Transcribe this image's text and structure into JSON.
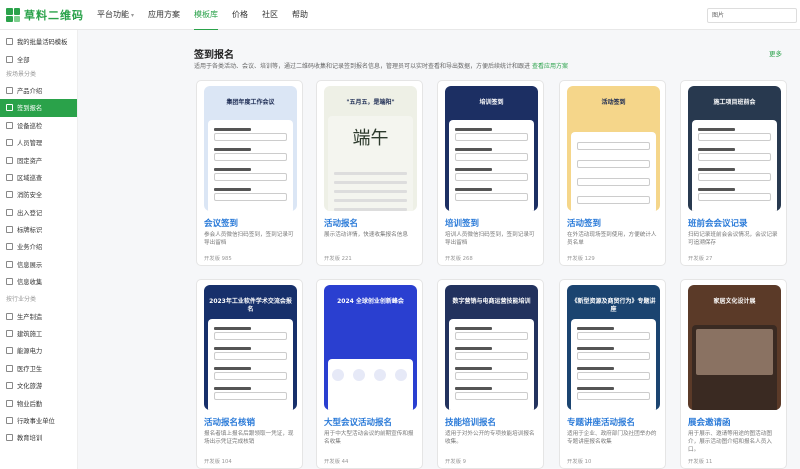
{
  "brand": {
    "name": "草料二维码",
    "accent": "#2aa24a"
  },
  "nav": [
    {
      "label": "平台功能",
      "dropdown": true
    },
    {
      "label": "应用方案",
      "dropdown": false
    },
    {
      "label": "模板库",
      "dropdown": false,
      "active": true
    },
    {
      "label": "价格",
      "dropdown": false
    },
    {
      "label": "社区",
      "dropdown": false
    },
    {
      "label": "帮助",
      "dropdown": false
    }
  ],
  "search": {
    "value": "图片"
  },
  "sidebar": {
    "my_template": "我的批量活码模板",
    "all": "全部",
    "group1": "按场景分类",
    "scenes": [
      "产品介绍",
      "签到报名",
      "设备巡检",
      "人员管理",
      "固定资产",
      "区域巡查",
      "消防安全",
      "出入登记",
      "标牌标识",
      "业务介绍",
      "信息展示",
      "信息收集"
    ],
    "group2": "按行业分类",
    "industries": [
      "生产制造",
      "建筑施工",
      "能源电力",
      "医疗卫生",
      "文化旅游",
      "物业后勤",
      "行政事业单位",
      "教育培训"
    ],
    "active_index": 1
  },
  "section": {
    "title": "签到报名",
    "desc": "适用于各类活动、会议、培训等，通过二维码收集和记录签到报名信息，管理员可以实时查看和导出数据，方便后续统计和跟进",
    "desc_link": "查看应用方案",
    "more": "更多"
  },
  "cards": [
    {
      "title": "会议签到",
      "desc": "参会人员微信扫码签到，签到记录可导出留档",
      "count": "开发版 985",
      "thumb_title": "集团年度工作会议",
      "thumb_bg": "#dbe6f5",
      "theme": "conf"
    },
    {
      "title": "活动报名",
      "desc": "展示活动详情，快速收集报名信息",
      "count": "开发版 221",
      "thumb_title": "\"五月五，是端阳\"",
      "thumb_bg": "#eef0e6",
      "theme": "dragon"
    },
    {
      "title": "培训签到",
      "desc": "培训人员微信扫码签到，签到记录可导出留档",
      "count": "开发版 268",
      "thumb_title": "培训签到",
      "thumb_bg": "#1c2f63",
      "theme": "train"
    },
    {
      "title": "活动签到",
      "desc": "在外活动现场签到使用，方便统计人员名单",
      "count": "开发版 129",
      "thumb_title": "活动签到",
      "thumb_bg": "#f5d68a",
      "theme": "event"
    },
    {
      "title": "班前会会议记录",
      "desc": "扫码记录班前会会议情况，会议记录可追溯保存",
      "count": "开发版 27",
      "thumb_title": "施工项目班前会",
      "thumb_bg": "#28394f",
      "theme": "site"
    },
    {
      "title": "活动报名核销",
      "desc": "报名者填上报名后跟领取一凭证，现场出示凭证完成核销",
      "count": "开发版 104",
      "thumb_title": "2023年工业软件学术交流会报名",
      "thumb_bg": "#17306b",
      "theme": "soft"
    },
    {
      "title": "大型会议活动报名",
      "desc": "用于中大型活动会议的前期宣传和报名收集",
      "count": "开发版 44",
      "thumb_title": "2024 全球创业创新峰会",
      "thumb_bg": "#2a3fd0",
      "theme": "summit"
    },
    {
      "title": "技能培训报名",
      "desc": "适用于对外公开的专项技能培训报名收集。",
      "count": "开发版 9",
      "thumb_title": "数字营销与电商运营技能培训",
      "thumb_bg": "#22325e",
      "theme": "skill"
    },
    {
      "title": "专题讲座活动报名",
      "desc": "适用于企业、政府部门及社团举办的专题讲座报名收集",
      "count": "开发版 10",
      "thumb_title": "《新型资源及商贸行为》专题讲座",
      "thumb_bg": "#1b4470",
      "theme": "lecture"
    },
    {
      "title": "展会邀请函",
      "desc": "用于展示、邀请等用途的图活动图介，展示活动图介绍和报名人员入口。",
      "count": "开发版 11",
      "thumb_title": "家居文化设计展",
      "thumb_bg": "#5b3a28",
      "theme": "expo"
    }
  ]
}
